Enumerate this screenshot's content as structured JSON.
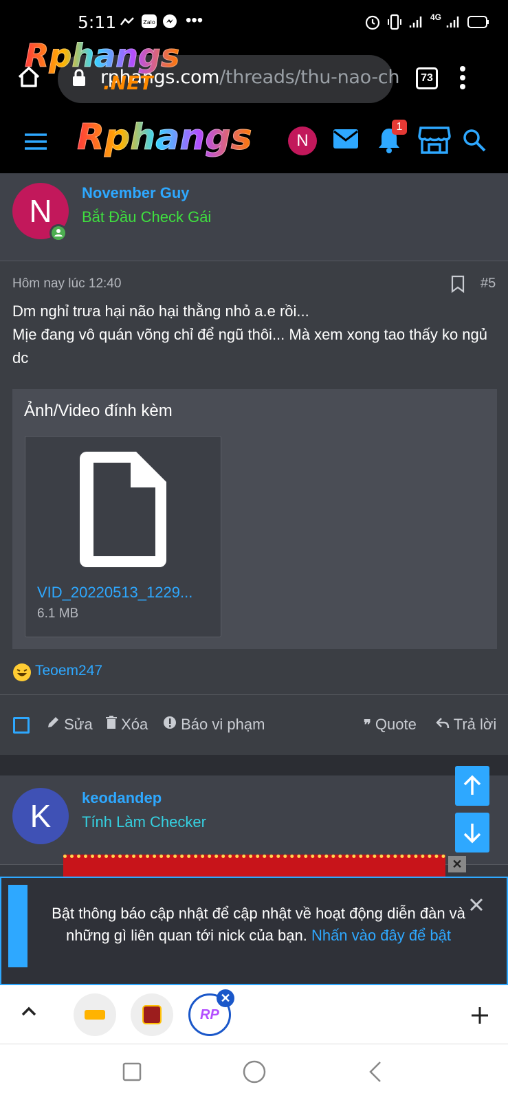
{
  "status_bar": {
    "time": "5:11",
    "icons": [
      "missed-call-icon",
      "zalo-icon",
      "messenger-icon",
      "more-icon",
      "alarm-icon",
      "vibrate-icon",
      "signal-icon",
      "4g-icon",
      "battery-icon"
    ],
    "network_label": "4G"
  },
  "browser": {
    "url_host": "rphangs.com",
    "url_path": "/threads/thu-nao-ch",
    "tab_count": "73",
    "overlay_logo": "Rphangs",
    "overlay_logo_suffix": ".NET"
  },
  "site_header": {
    "logo": "Rphangs",
    "avatar_letter": "N",
    "notification_count": "1",
    "accent": "#2ea8ff"
  },
  "post1": {
    "avatar_letter": "N",
    "avatar_color": "#c2185b",
    "username": "November Guy",
    "user_title": "Bắt Đầu Check Gái",
    "user_title_color": "#3fe03f",
    "timestamp": "Hôm nay lúc 12:40",
    "post_number": "#5",
    "body_line1": "Dm nghỉ trưa hại não hại thằng nhỏ a.e rồi...",
    "body_line2": "Mịe đang vô quán võng chỉ để ngũ thôi... Mà xem xong tao thấy ko ngủ dc",
    "attachments_title": "Ảnh/Video đính kèm",
    "attachment_name": "VID_20220513_1229...",
    "attachment_size": "6.1 MB",
    "reaction_user": "Teoem247",
    "actions": {
      "edit": "Sửa",
      "delete": "Xóa",
      "report": "Báo vi phạm",
      "quote": "Quote",
      "reply": "Trả lời"
    }
  },
  "post2": {
    "avatar_letter": "K",
    "avatar_color": "#3f51b5",
    "username": "keodandep",
    "user_title": "Tính Làm Checker",
    "user_title_color": "#35d0e0"
  },
  "notice": {
    "text": "Bật thông báo cập nhật để cập nhật về hoạt động diễn đàn và những gì liên quan tới nick của bạn.",
    "link": "Nhấn vào đây để bật"
  },
  "tab_strip": {
    "tabs": [
      "rikvip-tab",
      "kingfun-tab",
      "rphangs-tab"
    ],
    "active_label": "RP"
  }
}
